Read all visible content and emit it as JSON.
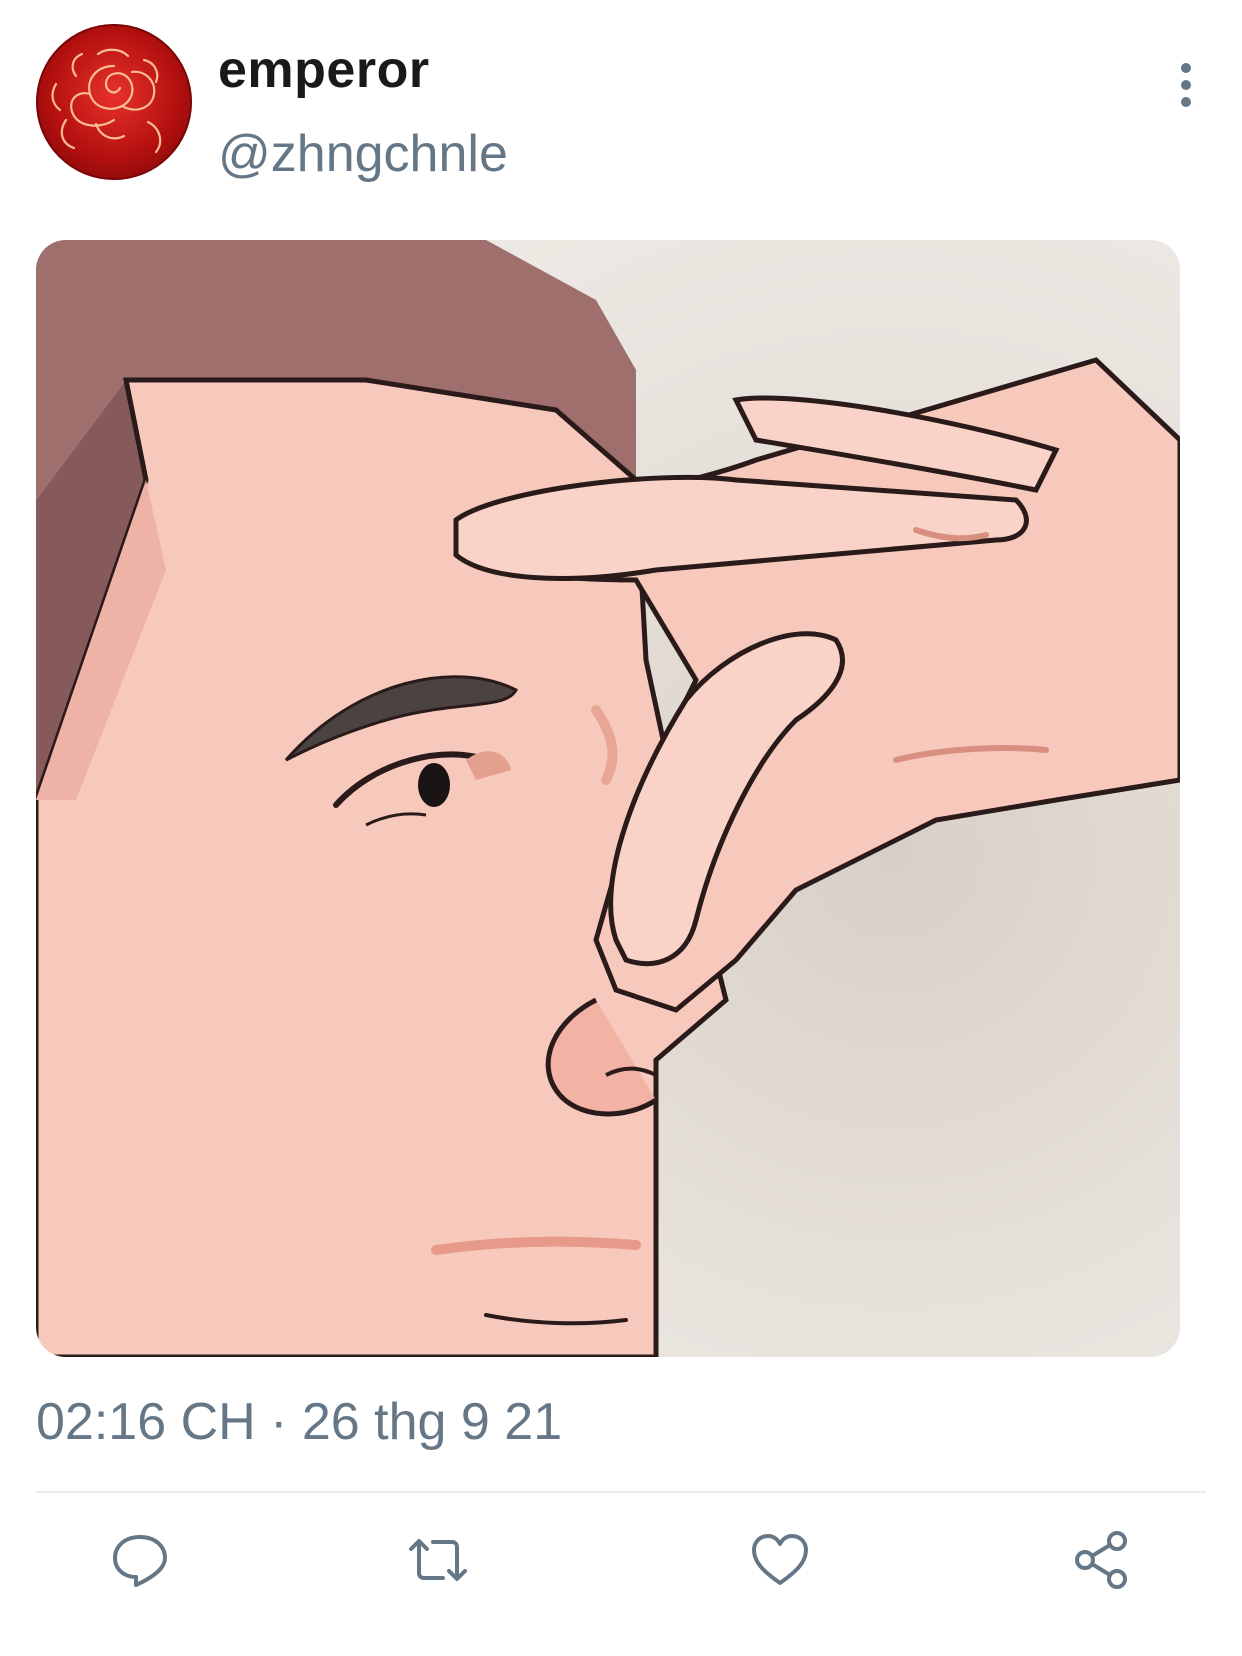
{
  "tweet": {
    "author": {
      "display_name": "emperor",
      "handle": "@zhngchnle",
      "avatar_icon": "red-rose-avatar"
    },
    "media": {
      "icon": "cartoon-face-hand-on-nose-illustration"
    },
    "timestamp": "02:16 CH · 26 thg 9 21",
    "actions": [
      {
        "name": "reply",
        "icon": "reply-icon"
      },
      {
        "name": "retweet",
        "icon": "retweet-icon"
      },
      {
        "name": "like",
        "icon": "heart-icon"
      },
      {
        "name": "share",
        "icon": "share-icon"
      }
    ]
  },
  "colors": {
    "secondary_text": "#657786",
    "primary_text": "#1a1a1a",
    "divider": "#e6ecf0",
    "avatar_red": "#c8141a"
  }
}
